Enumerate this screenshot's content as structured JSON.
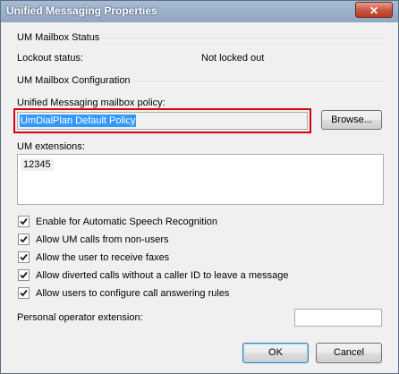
{
  "window": {
    "title": "Unified Messaging Properties",
    "close_icon": "close-icon"
  },
  "mailbox_status": {
    "heading": "UM Mailbox Status",
    "lockout_label": "Lockout status:",
    "lockout_value": "Not locked out"
  },
  "mailbox_config": {
    "heading": "UM Mailbox Configuration",
    "policy_label": "Unified Messaging mailbox policy:",
    "policy_value": "UmDialPlan Default Policy",
    "browse_label": "Browse...",
    "extensions_label": "UM extensions:",
    "extensions": [
      "12345"
    ]
  },
  "options": [
    {
      "label": "Enable for Automatic Speech Recognition",
      "checked": true
    },
    {
      "label": "Allow UM calls from non-users",
      "checked": true
    },
    {
      "label": "Allow the user to receive faxes",
      "checked": true
    },
    {
      "label": "Allow diverted calls without a caller ID to leave a message",
      "checked": true
    },
    {
      "label": "Allow users to configure call answering rules",
      "checked": true
    }
  ],
  "operator": {
    "label": "Personal operator extension:",
    "value": ""
  },
  "buttons": {
    "ok": "OK",
    "cancel": "Cancel"
  },
  "colors": {
    "highlight_border": "#d9000d",
    "selection": "#3399ff",
    "titlebar": "#8fa6c0"
  }
}
